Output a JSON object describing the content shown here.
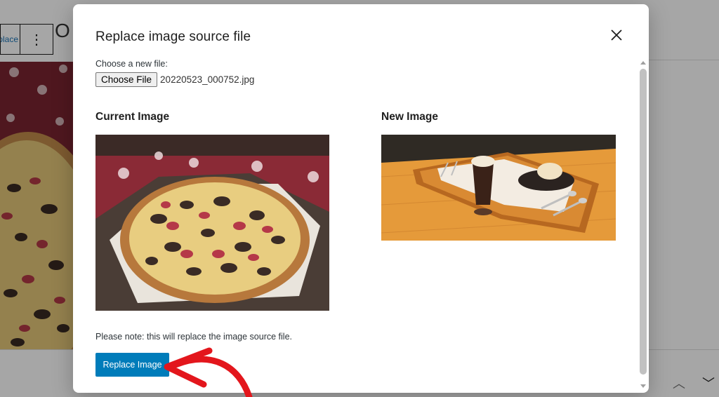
{
  "background": {
    "toolbar_replace_label": "Replace",
    "toolbar_more_icon": "more-vertical-icon",
    "heading_fragment": "O"
  },
  "modal": {
    "title": "Replace image source file",
    "close_icon": "close-icon",
    "choose_label": "Choose a new file:",
    "choose_button": "Choose File",
    "file_name": "20220523_000752.jpg",
    "current_label": "Current Image",
    "new_label": "New Image",
    "note": "Please note: this will replace the image source file.",
    "replace_button": "Replace Image"
  },
  "colors": {
    "primary_button": "#007cba",
    "annotation_arrow": "#e3161c"
  }
}
